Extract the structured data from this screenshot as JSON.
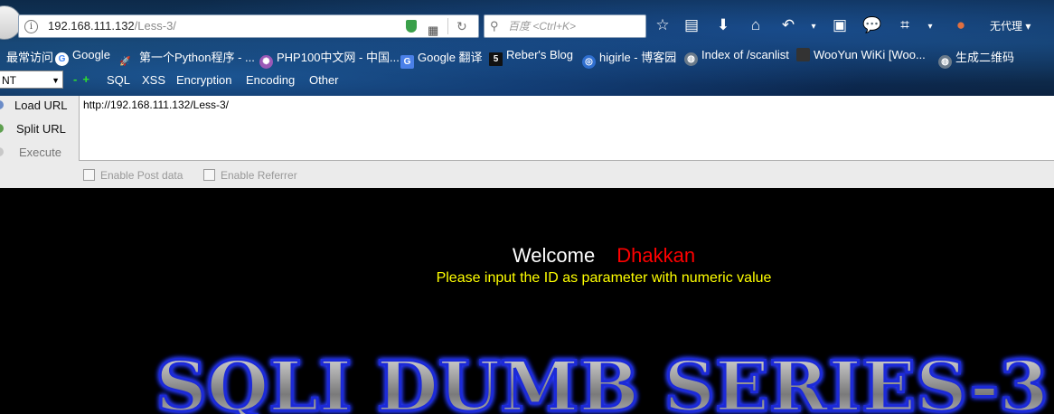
{
  "browser": {
    "url_host": "192.168.111.132",
    "url_path": "/Less-3/",
    "search_placeholder": "百度 <Ctrl+K>",
    "proxy_label": "无代理",
    "toolbar_icons": [
      "star-icon",
      "reading-list-icon",
      "download-icon",
      "home-icon",
      "undo-icon",
      "dropdown-icon",
      "screenshot-icon",
      "chat-icon",
      "crop-icon",
      "dropdown-icon",
      "extension-icon"
    ]
  },
  "bookmarks": [
    {
      "label": "最常访问",
      "icon": "bookmark-icon"
    },
    {
      "label": "Google",
      "icon": "google-icon"
    },
    {
      "label": "第一个Python程序 - ...",
      "icon": "rocket-icon"
    },
    {
      "label": "PHP100中文网 - 中国...",
      "icon": "php-icon"
    },
    {
      "label": "Google 翻译",
      "icon": "translate-icon"
    },
    {
      "label": "Reber's Blog",
      "icon": "blog-icon"
    },
    {
      "label": "higirle - 博客园",
      "icon": "globe-icon"
    },
    {
      "label": "Index of /scanlist",
      "icon": "globe-icon"
    },
    {
      "label": "WooYun WiKi [Woo...",
      "icon": "wooyun-icon"
    },
    {
      "label": "生成二维码",
      "icon": "globe-icon"
    }
  ],
  "hackbar": {
    "select_value": "NT",
    "menu": [
      "SQL",
      "XSS",
      "Encryption",
      "Encoding",
      "Other"
    ],
    "buttons": {
      "load": "Load URL",
      "split": "Split URL",
      "execute": "Execute"
    },
    "url_value": "http://192.168.111.132/Less-3/",
    "checkboxes": {
      "post": "Enable Post data",
      "referrer": "Enable Referrer"
    }
  },
  "page": {
    "welcome": "Welcome",
    "name": "Dhakkan",
    "prompt": "Please input the ID as parameter with numeric value",
    "banner": "SQLI DUMB SERIES-3"
  },
  "colors": {
    "welcome": "#ffffff",
    "name": "#ff0000",
    "prompt": "#ffff00",
    "banner_glow": "#2a3cff"
  }
}
